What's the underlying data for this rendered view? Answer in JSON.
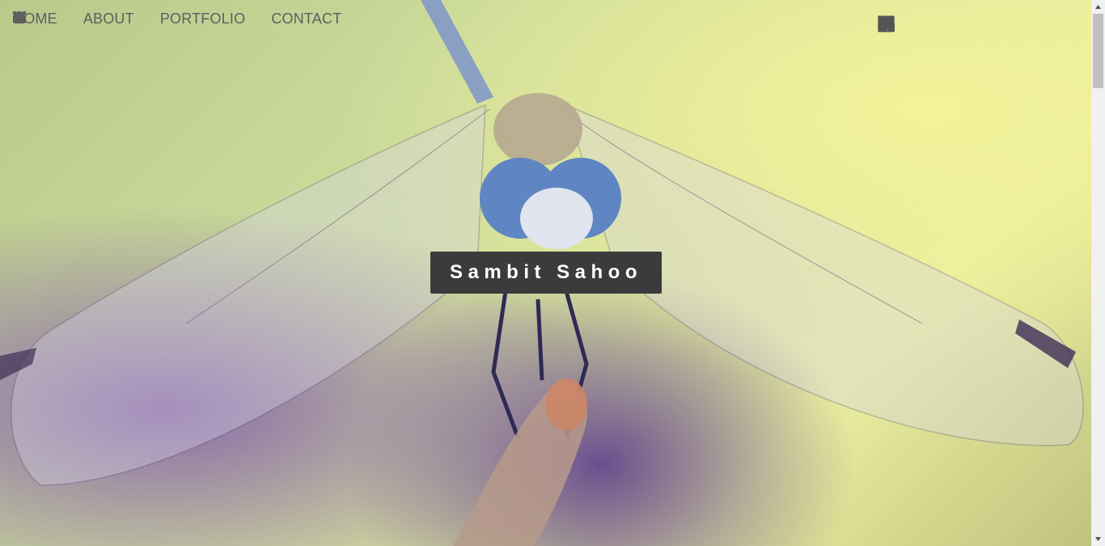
{
  "nav": {
    "items": [
      {
        "label": "HOME",
        "icon": "home-icon"
      },
      {
        "label": "ABOUT",
        "icon": "user-icon"
      },
      {
        "label": "PORTFOLIO",
        "icon": "grid-icon"
      },
      {
        "label": "CONTACT",
        "icon": "envelope-icon"
      }
    ]
  },
  "social": {
    "items": [
      {
        "icon": "github-icon"
      },
      {
        "icon": "linkedin-icon"
      },
      {
        "icon": "twitter-icon"
      },
      {
        "icon": "instagram-icon"
      },
      {
        "icon": "facebook-icon"
      }
    ]
  },
  "hero": {
    "name": "Sambit Sahoo",
    "background": "dragonfly-photo"
  },
  "colors": {
    "nav_text": "#5e5e5e",
    "name_box_bg": "#3b3b3b",
    "name_text": "#ffffff"
  }
}
